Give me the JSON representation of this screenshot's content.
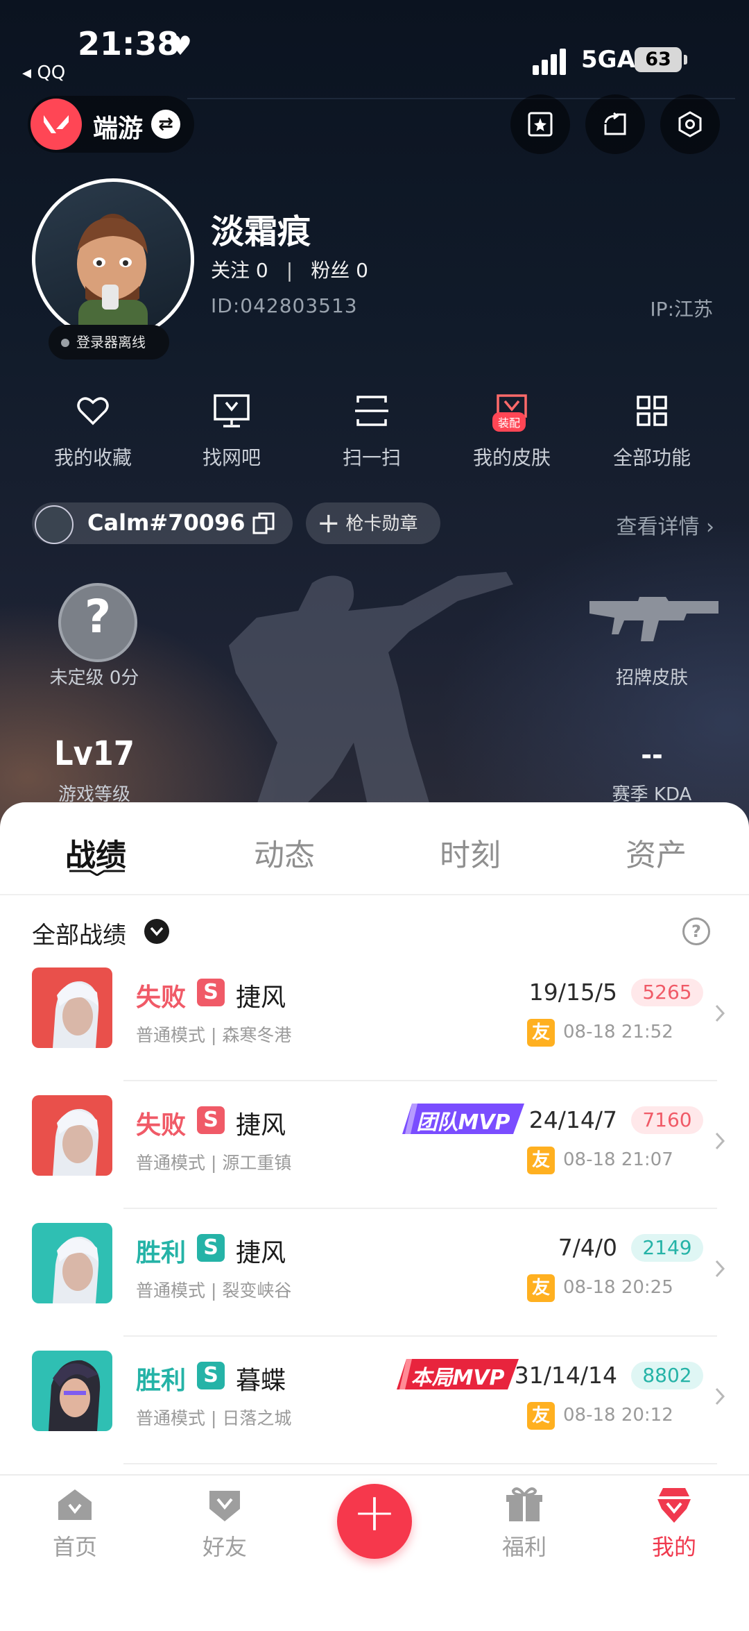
{
  "status_bar": {
    "time": "21:38",
    "back_app": "◂ QQ",
    "network": "5GA",
    "battery": "63"
  },
  "header": {
    "mode_label": "端游",
    "icons": [
      "star-card-icon",
      "share-icon",
      "settings-icon"
    ]
  },
  "profile": {
    "username": "淡霜痕",
    "following_label": "关注",
    "following_count": "0",
    "fans_label": "粉丝",
    "fans_count": "0",
    "id": "ID:042803513",
    "ip": "IP:江苏",
    "login_status": "登录器离线"
  },
  "shortcuts": [
    {
      "label": "我的收藏",
      "icon": "heart-icon"
    },
    {
      "label": "找网吧",
      "icon": "monitor-icon"
    },
    {
      "label": "扫一扫",
      "icon": "scan-icon"
    },
    {
      "label": "我的皮肤",
      "icon": "skin-icon",
      "badge": "装配"
    },
    {
      "label": "全部功能",
      "icon": "grid-icon"
    }
  ],
  "riot": {
    "name": "Calm#70096",
    "badge_button": "枪卡勋章",
    "detail_link": "查看详情"
  },
  "stats": {
    "rank_symbol": "?",
    "rank_label": "未定级 0分",
    "skin_label": "招牌皮肤",
    "level": "Lv17",
    "level_label": "游戏等级",
    "kda": "--",
    "kda_label": "赛季 KDA"
  },
  "tabs": [
    "战绩",
    "动态",
    "时刻",
    "资产"
  ],
  "filter": {
    "label": "全部战绩"
  },
  "matches": [
    {
      "result": "失败",
      "outcome": "lose",
      "rank_letter": "S",
      "agent": "捷风",
      "mode_map": "普通模式 | 森寒冬港",
      "mvp": "",
      "kda": "19/15/5",
      "score": "5265",
      "friend_badge": "友",
      "time": "08-18 21:52"
    },
    {
      "result": "失败",
      "outcome": "lose",
      "rank_letter": "S",
      "agent": "捷风",
      "mode_map": "普通模式 | 源工重镇",
      "mvp": "团队MVP",
      "kda": "24/14/7",
      "score": "7160",
      "friend_badge": "友",
      "time": "08-18 21:07"
    },
    {
      "result": "胜利",
      "outcome": "win",
      "rank_letter": "S",
      "agent": "捷风",
      "mode_map": "普通模式 | 裂变峡谷",
      "mvp": "",
      "kda": "7/4/0",
      "score": "2149",
      "friend_badge": "友",
      "time": "08-18 20:25"
    },
    {
      "result": "胜利",
      "outcome": "win",
      "rank_letter": "S",
      "agent": "暮蝶",
      "mode_map": "普通模式 | 日落之城",
      "mvp": "本局MVP",
      "kda": "31/14/14",
      "score": "8802",
      "friend_badge": "友",
      "time": "08-18 20:12"
    }
  ],
  "nav": [
    {
      "label": "首页",
      "icon": "home-icon"
    },
    {
      "label": "好友",
      "icon": "friends-icon"
    },
    {
      "label": "",
      "icon": "plus-icon"
    },
    {
      "label": "福利",
      "icon": "gift-icon"
    },
    {
      "label": "我的",
      "icon": "profile-icon"
    }
  ],
  "colors": {
    "accent": "#ff4655",
    "lose": "#f05a67",
    "win": "#25b3a7",
    "team_mvp": "#7a4dff",
    "match_mvp": "#e8243d"
  }
}
